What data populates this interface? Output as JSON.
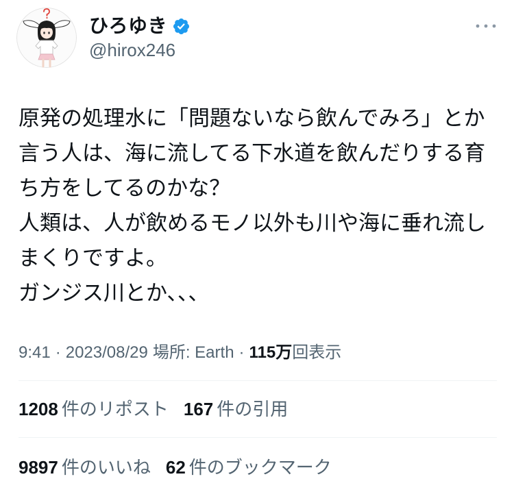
{
  "author": {
    "display_name": "ひろゆき",
    "handle": "@hirox246"
  },
  "icons": {
    "avatar": "avatar",
    "verified": "verified-badge-icon",
    "more": "more-options-icon"
  },
  "tweet": {
    "lines": [
      "原発の処理水に「問題ないなら飲んでみろ」とか",
      "言う人は、海に流してる下水道を飲んだりする育",
      "ち方をしてるのかな？",
      "人類は、人が飲めるモノ以外も川や海に垂れ流し",
      "まくりですよ。",
      "ガンジス川とか、、、"
    ]
  },
  "meta": {
    "time": "9:41",
    "separator": "·",
    "date": "2023/08/29",
    "location": "場所: Earth",
    "views_count": "115万",
    "views_label": "回表示"
  },
  "stats": {
    "reposts": {
      "count": "1208",
      "label": "件のリポスト"
    },
    "quotes": {
      "count": "167",
      "label": "件の引用"
    },
    "likes": {
      "count": "9897",
      "label": "件のいいね"
    },
    "bookmarks": {
      "count": "62",
      "label": "件のブックマーク"
    }
  },
  "colors": {
    "text": "#0f1419",
    "secondary": "#536471",
    "accent": "#1d9bf0",
    "divider": "#eff3f4"
  }
}
